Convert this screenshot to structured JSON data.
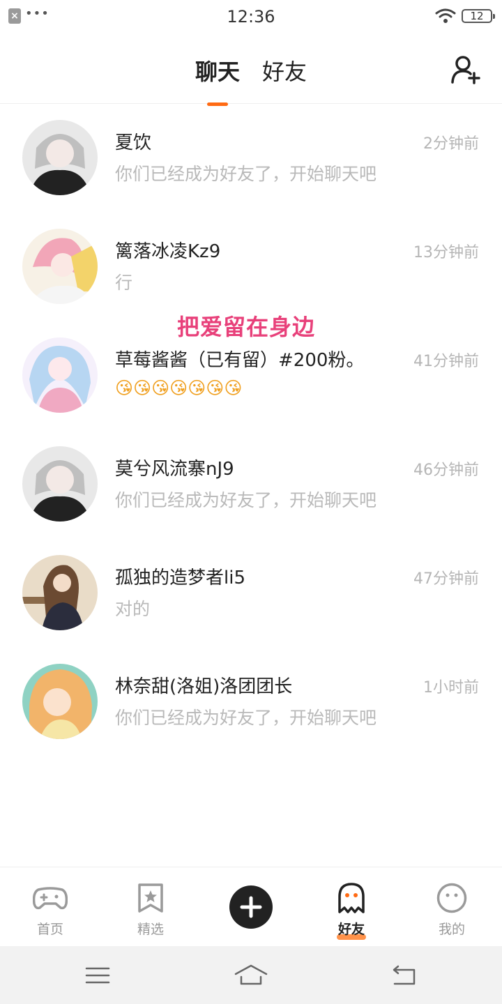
{
  "status_bar": {
    "time": "12:36",
    "battery": "12"
  },
  "header": {
    "tabs": [
      {
        "label": "聊天",
        "active": true
      },
      {
        "label": "好友",
        "active": false
      }
    ]
  },
  "overlay_text": "把爱留在身边",
  "chats": [
    {
      "name": "夏饮",
      "time": "2分钟前",
      "preview": "你们已经成为好友了，开始聊天吧",
      "avatar_color": "#3b3b3b"
    },
    {
      "name": "篱落冰凌Kz9",
      "time": "13分钟前",
      "preview": "行",
      "avatar_color": "#f2a6b8"
    },
    {
      "name": "草莓酱酱（已有留）#200粉。",
      "time": "41分钟前",
      "preview": "😘😘😘😘😘😘😘",
      "avatar_color": "#c9b6e4"
    },
    {
      "name": "莫兮风流寨nJ9",
      "time": "46分钟前",
      "preview": "你们已经成为好友了，开始聊天吧",
      "avatar_color": "#3b3b3b"
    },
    {
      "name": "孤独的造梦者li5",
      "time": "47分钟前",
      "preview": "对的",
      "avatar_color": "#6b5340"
    },
    {
      "name": "林奈甜(洛姐)洛团团长",
      "time": "1小时前",
      "preview": "你们已经成为好友了，开始聊天吧",
      "avatar_color": "#8fd2c3"
    }
  ],
  "bottom_nav": [
    {
      "label": "首页",
      "icon": "gamepad-icon",
      "active": false
    },
    {
      "label": "精选",
      "icon": "star-bookmark-icon",
      "active": false
    },
    {
      "label": "",
      "icon": "plus-icon",
      "active": false
    },
    {
      "label": "好友",
      "icon": "ghost-icon",
      "active": true
    },
    {
      "label": "我的",
      "icon": "smiley-icon",
      "active": false
    }
  ],
  "colors": {
    "accent": "#ff6a13",
    "overlay": "#e8407a",
    "muted_text": "#b9b9b9"
  }
}
